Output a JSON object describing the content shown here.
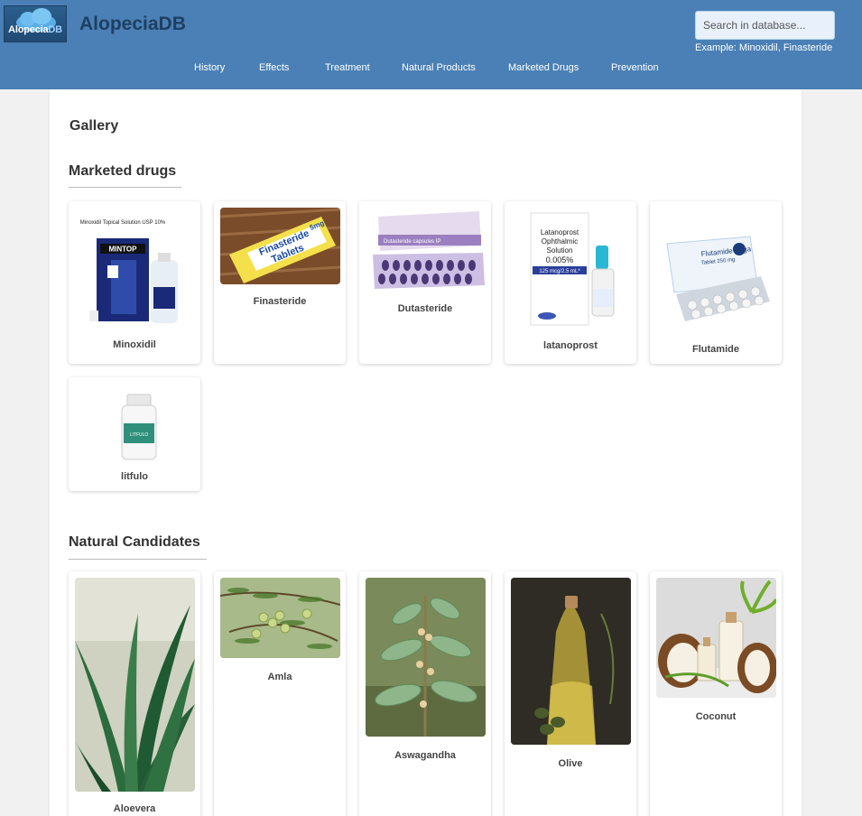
{
  "header": {
    "logo_text_a": "Alopecia",
    "logo_text_b": "DB",
    "site_title": "AlopeciaDB",
    "search_placeholder": "Search in database...",
    "search_example": "Example: Minoxidil, Finasteride"
  },
  "nav": [
    "History",
    "Effects",
    "Treatment",
    "Natural Products",
    "Marketed Drugs",
    "Prevention"
  ],
  "main": {
    "gallery_title": "Gallery",
    "marketed_title": "Marketed drugs",
    "natural_title": "Natural Candidates",
    "marketed_items": [
      "Minoxidil",
      "Finasteride",
      "Dutasteride",
      "latanoprost",
      "Flutamide",
      "litfulo"
    ],
    "natural_items": [
      "Aloevera",
      "Amla",
      "Aswagandha",
      "Olive",
      "Coconut"
    ],
    "product_text": {
      "minoxidil_box": "MINTOP",
      "minoxidil_line": "Minoxidil Topical Solution USP 10%",
      "finasteride_box": "Finasteride",
      "finasteride_sub": "Tablets",
      "finasteride_mg": "5mg",
      "dutasteride_box": "Dutasteride capsules IP",
      "latanoprost_line1": "Latanoprost",
      "latanoprost_line2": "Ophthalmic",
      "latanoprost_line3": "Solution",
      "latanoprost_line4": "0.005%",
      "latanoprost_line5": "125 mcg/2.5 mL*",
      "flutamide_box": "Flutamide Vega",
      "flutamide_sub": "Tablet 250 mg",
      "litfulo_bottle": "LITFULO"
    }
  },
  "colors": {
    "header_bg": "#4a80b5",
    "title": "#1e3f62"
  }
}
